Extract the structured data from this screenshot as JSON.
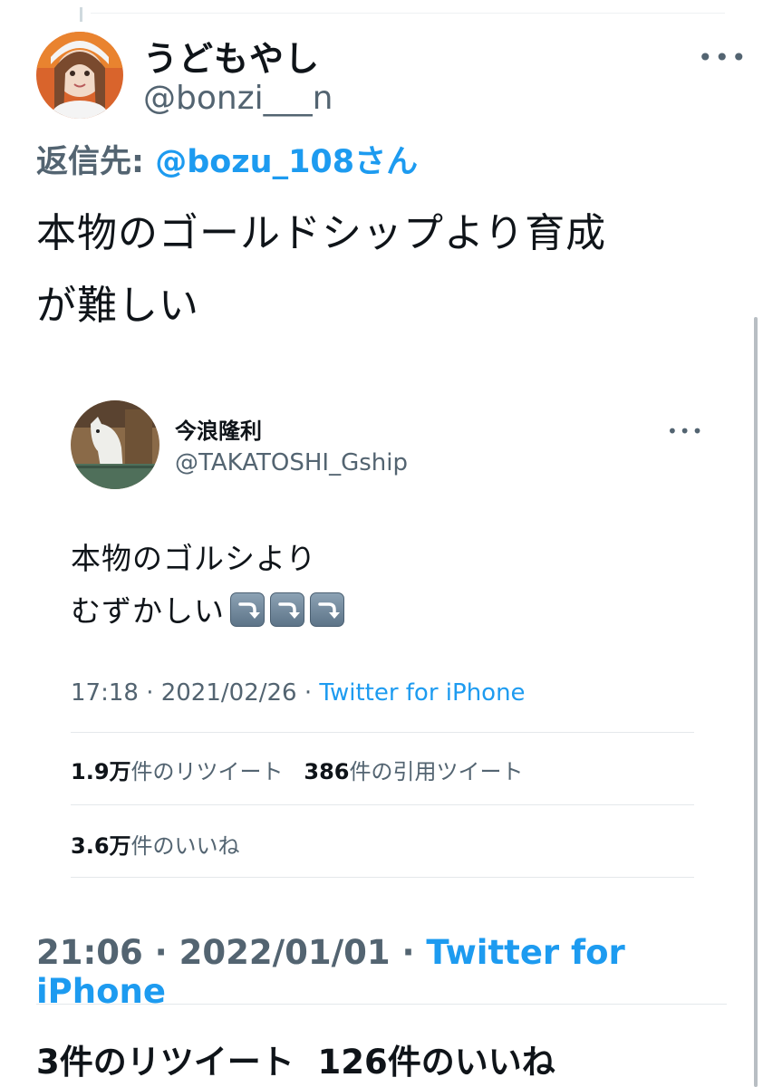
{
  "tweet": {
    "display_name": "うどもやし",
    "handle": "@bonzi___n",
    "reply_prefix": "返信先:",
    "reply_to": "@bozu_108さん",
    "text_line1": "本物のゴールドシップより育成",
    "text_line2": "が難しい",
    "timestamp": "21:06 · 2022/01/01 ·",
    "source": "Twitter for iPhone",
    "retweets": "3",
    "retweets_label": "件のリツイート",
    "likes": "126",
    "likes_label": "件のいいね"
  },
  "quoted": {
    "display_name": "今浪隆利",
    "handle": "@TAKATOSHI_Gship",
    "text_line1": "本物のゴルシより",
    "text_line2": "むずかしい",
    "arrow_emoji": "⤵️",
    "timestamp": "17:18 · 2021/02/26 ·",
    "source": "Twitter for iPhone",
    "retweets": "1.9万",
    "retweets_label": "件のリツイート",
    "quotes": "386",
    "quotes_label": "件の引用ツイート",
    "likes": "3.6万",
    "likes_label": "件のいいね"
  },
  "icons": {
    "more": "more-horizontal-icon",
    "arrow": "arrow-right-curving-down-icon"
  },
  "colors": {
    "link": "#1d9bf0",
    "secondary_text": "#536471",
    "primary_text": "#0f1419"
  }
}
